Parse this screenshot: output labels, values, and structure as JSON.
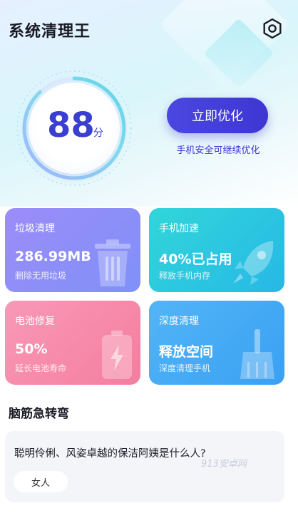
{
  "app": {
    "title": "系统清理王"
  },
  "score": {
    "value": "88",
    "unit": "分"
  },
  "optimize": {
    "button_label": "立即优化",
    "hint": "手机安全可继续优化"
  },
  "cards": [
    {
      "title": "垃圾清理",
      "value": "286.99MB",
      "subtitle": "删除无用垃圾",
      "icon": "trash-icon"
    },
    {
      "title": "手机加速",
      "value": "40%已占用",
      "subtitle": "释放手机内存",
      "icon": "rocket-icon"
    },
    {
      "title": "电池修复",
      "value": "50%",
      "subtitle": "延长电池寿命",
      "icon": "battery-icon"
    },
    {
      "title": "深度清理",
      "value": "释放空间",
      "subtitle": "深度清理手机",
      "icon": "broom-icon"
    }
  ],
  "riddle": {
    "section_title": "脑筋急转弯",
    "question": "聪明伶俐、风姿卓越的保洁阿姨是什么人?",
    "answer": "女人"
  },
  "watermark": "913安卓网",
  "colors": {
    "accent": "#3f36d4",
    "junk_card": "#8e8ef8",
    "speed_card": "#2ec8df",
    "battery_card": "#f68aab",
    "deep_card": "#47aaf5"
  }
}
